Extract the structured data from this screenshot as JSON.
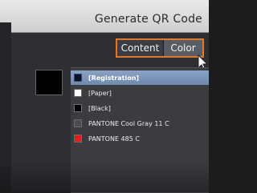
{
  "window": {
    "title": "Generate QR Code"
  },
  "tabs": [
    {
      "label": "Content",
      "active": false
    },
    {
      "label": "Color",
      "active": true
    }
  ],
  "colors": {
    "tab_border": "#e07a2a",
    "selection": "#7b93b8",
    "preview_swatch": "#000000"
  },
  "swatches": [
    {
      "label": "[Registration]",
      "color": "#0b1230",
      "selected": true
    },
    {
      "label": "[Paper]",
      "color": "#ffffff",
      "selected": false
    },
    {
      "label": "[Black]",
      "color": "#000000",
      "selected": false
    },
    {
      "label": "PANTONE Cool Gray 11 C",
      "color": "#4b4d52",
      "selected": false
    },
    {
      "label": "PANTONE 485 C",
      "color": "#e0201b",
      "selected": false
    }
  ]
}
